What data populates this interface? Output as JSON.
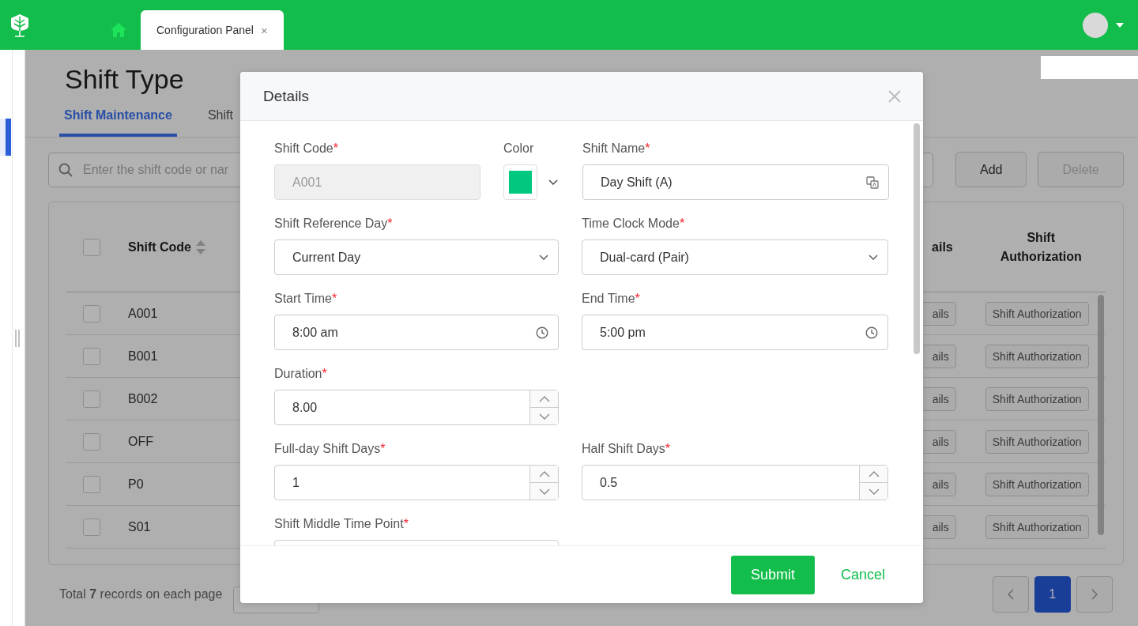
{
  "header": {
    "tabs": [
      {
        "label": "Configuration Panel",
        "selected": true,
        "close": "×"
      }
    ]
  },
  "page": {
    "title": "Shift Type",
    "tabs": [
      {
        "label": "Shift Maintenance",
        "selected": true
      },
      {
        "label": "Shift",
        "selected": false
      }
    ],
    "search": {
      "placeholder": "Enter the shift code or nar"
    },
    "buttons": [
      {
        "label": "Add",
        "disabled": false
      },
      {
        "label": "Delete",
        "disabled": true
      }
    ],
    "table": {
      "select_all": {
        "checked": false
      },
      "columns": [
        {
          "kind": "check"
        },
        {
          "kind": "code",
          "label": "Shift Code"
        },
        {
          "kind": "hidden"
        },
        {
          "kind": "details",
          "label": "ails"
        },
        {
          "kind": "auth",
          "label": "Shift Authorization"
        }
      ],
      "rows": [
        {
          "checked": false,
          "code": "A001",
          "details": "ails",
          "authorization": "Shift Authorization"
        },
        {
          "checked": false,
          "code": "B001",
          "details": "ails",
          "authorization": "Shift Authorization"
        },
        {
          "checked": false,
          "code": "B002",
          "details": "ails",
          "authorization": "Shift Authorization"
        },
        {
          "checked": false,
          "code": "OFF",
          "details": "ails",
          "authorization": "Shift Authorization"
        },
        {
          "checked": false,
          "code": "P0",
          "details": "ails",
          "authorization": "Shift Authorization"
        },
        {
          "checked": false,
          "code": "S01",
          "details": "ails",
          "authorization": "Shift Authorization"
        }
      ]
    },
    "footer": {
      "summary": "Total **7** records on each page",
      "pages": [
        {
          "label": "1",
          "selected": true
        }
      ]
    }
  },
  "modal": {
    "title": "Details",
    "rows": [
      [
        {
          "kind": "text",
          "label": "Shift Code",
          "required_mark": "*",
          "value": "A001",
          "disabled": true
        },
        {
          "kind": "color",
          "label": "Color",
          "color": "#00c97f"
        },
        {
          "kind": "text",
          "label": "Shift Name",
          "required_mark": "*",
          "value": "Day Shift (A)",
          "disabled": false,
          "translatable": true
        }
      ],
      [
        {
          "kind": "select",
          "label": "Shift Reference Day",
          "required_mark": "*",
          "value": "Current Day"
        },
        {
          "kind": "select",
          "label": "Time Clock Mode",
          "required_mark": "*",
          "value": "Dual-card (Pair)"
        }
      ],
      [
        {
          "kind": "time",
          "label": "Start Time",
          "required_mark": "*",
          "value": "8:00 am"
        },
        {
          "kind": "time",
          "label": "End Time",
          "required_mark": "*",
          "value": "5:00 pm"
        }
      ],
      [
        {
          "kind": "number",
          "label": "Duration",
          "required_mark": "*",
          "value": "8.00"
        }
      ],
      [
        {
          "kind": "number",
          "label": "Full-day Shift Days",
          "required_mark": "*",
          "value": "1"
        },
        {
          "kind": "number",
          "label": "Half Shift Days",
          "required_mark": "*",
          "value": "0.5"
        }
      ],
      [
        {
          "kind": "text",
          "label": "Shift Middle Time Point",
          "required_mark": "*",
          "disabled": false
        }
      ]
    ],
    "buttons": [
      {
        "kind": "primary",
        "label": "Submit"
      },
      {
        "kind": "link",
        "label": "Cancel"
      }
    ]
  }
}
